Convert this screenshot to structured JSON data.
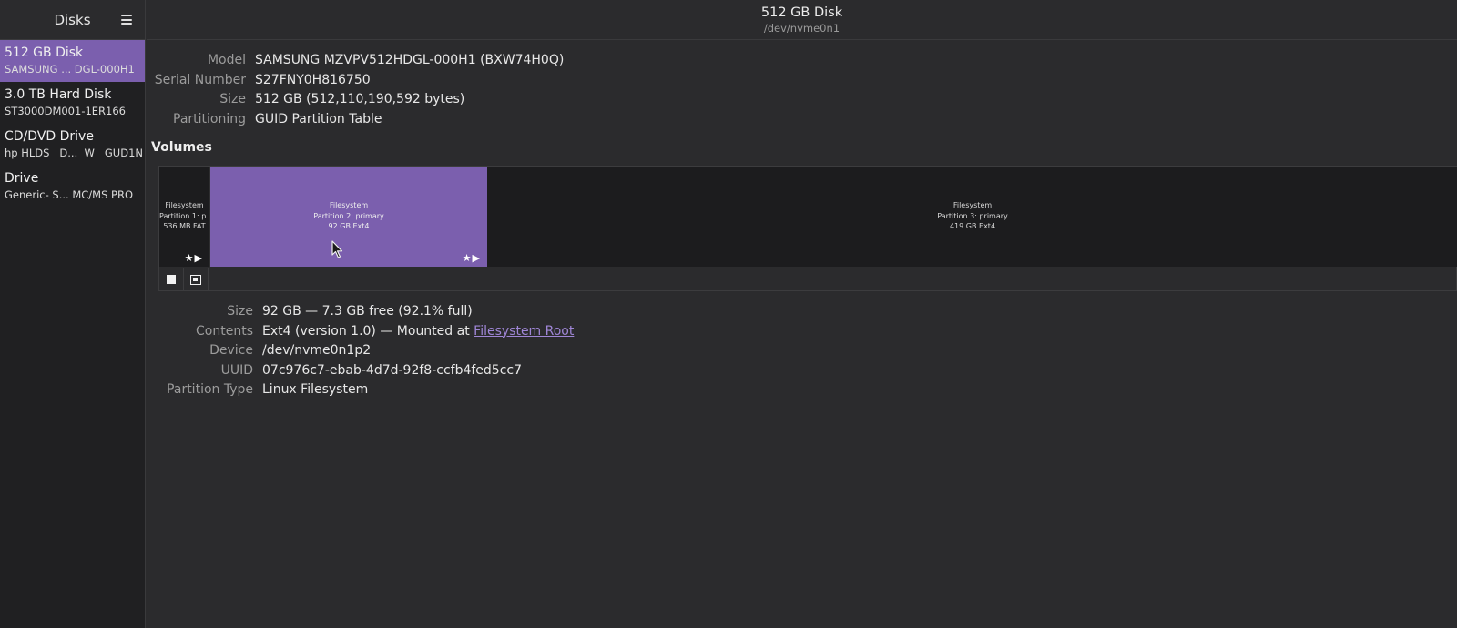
{
  "sidebar": {
    "title": "Disks",
    "menu_icon": "hamburger-menu-icon",
    "disks": [
      {
        "name": "512 GB Disk",
        "sub": "SAMSUNG ... DGL-000H1",
        "selected": true
      },
      {
        "name": "3.0 TB Hard Disk",
        "sub": "ST3000DM001-1ER166",
        "selected": false
      },
      {
        "name": "CD/DVD Drive",
        "sub": "hp HLDS   D...  W   GUD1N",
        "selected": false
      },
      {
        "name": "Drive",
        "sub": "Generic- S... MC/MS PRO",
        "selected": false
      }
    ]
  },
  "header": {
    "title": "512 GB Disk",
    "subtitle": "/dev/nvme0n1"
  },
  "disk_info": {
    "model_label": "Model",
    "model": "SAMSUNG MZVPV512HDGL-000H1 (BXW74H0Q)",
    "serial_label": "Serial Number",
    "serial": "S27FNY0H816750",
    "size_label": "Size",
    "size": "512 GB (512,110,190,592 bytes)",
    "partitioning_label": "Partitioning",
    "partitioning": "GUID Partition Table"
  },
  "volumes": {
    "heading": "Volumes",
    "partitions": [
      {
        "line1": "Filesystem",
        "line2": "Partition 1: p...",
        "line3": "536 MB FAT",
        "flags": "★▶"
      },
      {
        "line1": "Filesystem",
        "line2": "Partition 2: primary",
        "line3": "92 GB Ext4",
        "flags": "★▶",
        "selected": true
      },
      {
        "line1": "Filesystem",
        "line2": "Partition 3: primary",
        "line3": "419 GB Ext4"
      }
    ],
    "toolbar": {
      "stop_icon": "stop-square-icon",
      "options_icon": "partition-options-icon"
    }
  },
  "volume_info": {
    "size_label": "Size",
    "size": "92 GB — 7.3 GB free (92.1% full)",
    "contents_label": "Contents",
    "contents_prefix": "Ext4 (version 1.0) — Mounted at ",
    "contents_link": "Filesystem Root",
    "device_label": "Device",
    "device": "/dev/nvme0n1p2",
    "uuid_label": "UUID",
    "uuid": "07c976c7-ebab-4d7d-92f8-ccfb4fed5cc7",
    "ptype_label": "Partition Type",
    "ptype": "Linux Filesystem"
  },
  "colors": {
    "accent": "#7b5fae",
    "link": "#9f86d6",
    "background": "#2b2b2d",
    "sidebar": "#202022"
  }
}
